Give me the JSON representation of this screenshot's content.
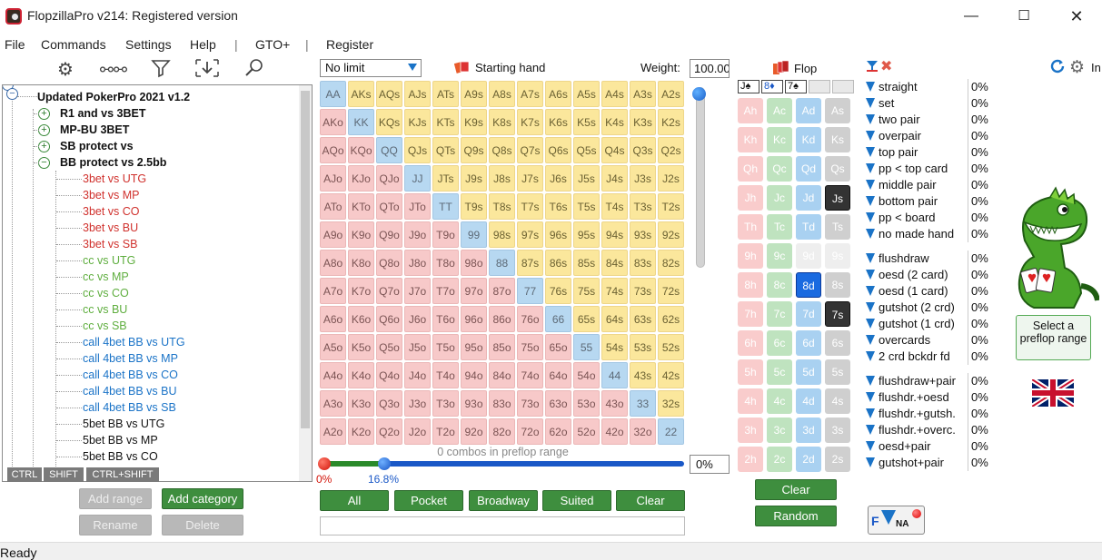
{
  "window": {
    "title": "FlopzillaPro v214: Registered version"
  },
  "menu": {
    "items": [
      "File",
      "Commands",
      "Settings",
      "Help",
      "|",
      "GTO+",
      "|",
      "Register"
    ]
  },
  "tree": {
    "root": "Updated PokerPro 2021 v1.2",
    "groups": [
      {
        "label": "R1 and vs 3BET",
        "toggle": "+"
      },
      {
        "label": "MP-BU 3BET",
        "toggle": "+"
      },
      {
        "label": "SB protect vs",
        "toggle": "+"
      },
      {
        "label": "BB protect vs 2.5bb",
        "toggle": "−"
      }
    ],
    "items": [
      {
        "label": "3bet vs UTG",
        "color": "#d0312d"
      },
      {
        "label": "3bet vs MP",
        "color": "#d0312d"
      },
      {
        "label": "3bet vs CO",
        "color": "#d0312d"
      },
      {
        "label": "3bet vs BU",
        "color": "#d0312d"
      },
      {
        "label": "3bet vs SB",
        "color": "#d0312d"
      },
      {
        "label": "cc vs UTG",
        "color": "#5fae3f"
      },
      {
        "label": "cc vs MP",
        "color": "#5fae3f"
      },
      {
        "label": "cc vs CO",
        "color": "#5fae3f"
      },
      {
        "label": "cc vs BU",
        "color": "#5fae3f"
      },
      {
        "label": "cc vs SB",
        "color": "#5fae3f"
      },
      {
        "label": "call 4bet BB vs UTG",
        "color": "#1a73c7"
      },
      {
        "label": "call 4bet BB vs MP",
        "color": "#1a73c7"
      },
      {
        "label": "call 4bet BB vs CO",
        "color": "#1a73c7"
      },
      {
        "label": "call 4bet BB vs BU",
        "color": "#1a73c7"
      },
      {
        "label": "call 4bet BB vs SB",
        "color": "#1a73c7"
      },
      {
        "label": "5bet BB vs UTG",
        "color": "#111111"
      },
      {
        "label": "5bet BB vs MP",
        "color": "#111111"
      },
      {
        "label": "5bet BB vs CO",
        "color": "#111111"
      }
    ],
    "keys": [
      "CTRL",
      "SHIFT",
      "CTRL+SHIFT"
    ]
  },
  "buttons": {
    "add_range": "Add range",
    "add_category": "Add category",
    "rename": "Rename",
    "delete": "Delete"
  },
  "range": {
    "limit": "No limit",
    "starting_hand_label": "Starting hand",
    "weight_label": "Weight:",
    "weight_value": "100.00",
    "combos_text": "0 combos in preflop range",
    "min_pct": "0%",
    "max_pct": "16.8%",
    "pct_value": "0%",
    "filters": [
      "All",
      "Pocket",
      "Broadway",
      "Suited",
      "Clear"
    ]
  },
  "grid": {
    "ranks": [
      "A",
      "K",
      "Q",
      "J",
      "T",
      "9",
      "8",
      "7",
      "6",
      "5",
      "4",
      "3",
      "2"
    ]
  },
  "flop": {
    "label": "Flop",
    "board": [
      "J♠",
      "8♦",
      "7♠",
      "",
      ""
    ],
    "clear": "Clear",
    "random": "Random",
    "ranks": [
      "A",
      "K",
      "Q",
      "J",
      "T",
      "9",
      "8",
      "7",
      "6",
      "5",
      "4",
      "3",
      "2"
    ],
    "suits": [
      "h",
      "c",
      "d",
      "s"
    ],
    "selected": [
      "Js",
      "8d",
      "7s"
    ],
    "disabled": [
      "9d",
      "9s"
    ]
  },
  "stats": {
    "made": [
      {
        "label": "straight",
        "value": "0%"
      },
      {
        "label": "set",
        "value": "0%"
      },
      {
        "label": "two pair",
        "value": "0%"
      },
      {
        "label": "overpair",
        "value": "0%"
      },
      {
        "label": "top pair",
        "value": "0%"
      },
      {
        "label": "pp < top card",
        "value": "0%"
      },
      {
        "label": "middle pair",
        "value": "0%"
      },
      {
        "label": "bottom pair",
        "value": "0%"
      },
      {
        "label": "pp < board",
        "value": "0%"
      },
      {
        "label": "no made hand",
        "value": "0%"
      }
    ],
    "draws": [
      {
        "label": "flushdraw",
        "value": "0%"
      },
      {
        "label": "oesd (2 card)",
        "value": "0%"
      },
      {
        "label": "oesd (1 card)",
        "value": "0%"
      },
      {
        "label": "gutshot (2 crd)",
        "value": "0%"
      },
      {
        "label": "gutshot (1 crd)",
        "value": "0%"
      },
      {
        "label": "overcards",
        "value": "0%"
      },
      {
        "label": "2 crd bckdr fd",
        "value": "0%"
      }
    ],
    "combo": [
      {
        "label": "flushdraw+pair",
        "value": "0%"
      },
      {
        "label": "flushdr.+oesd",
        "value": "0%"
      },
      {
        "label": "flushdr.+gutsh.",
        "value": "0%"
      },
      {
        "label": "flushdr.+overc.",
        "value": "0%"
      },
      {
        "label": "oesd+pair",
        "value": "0%"
      },
      {
        "label": "gutshot+pair",
        "value": "0%"
      }
    ]
  },
  "side": {
    "in_label": "In",
    "select_range": "Select a preflop range",
    "na_label": "NA"
  },
  "status": {
    "text": "Ready"
  }
}
